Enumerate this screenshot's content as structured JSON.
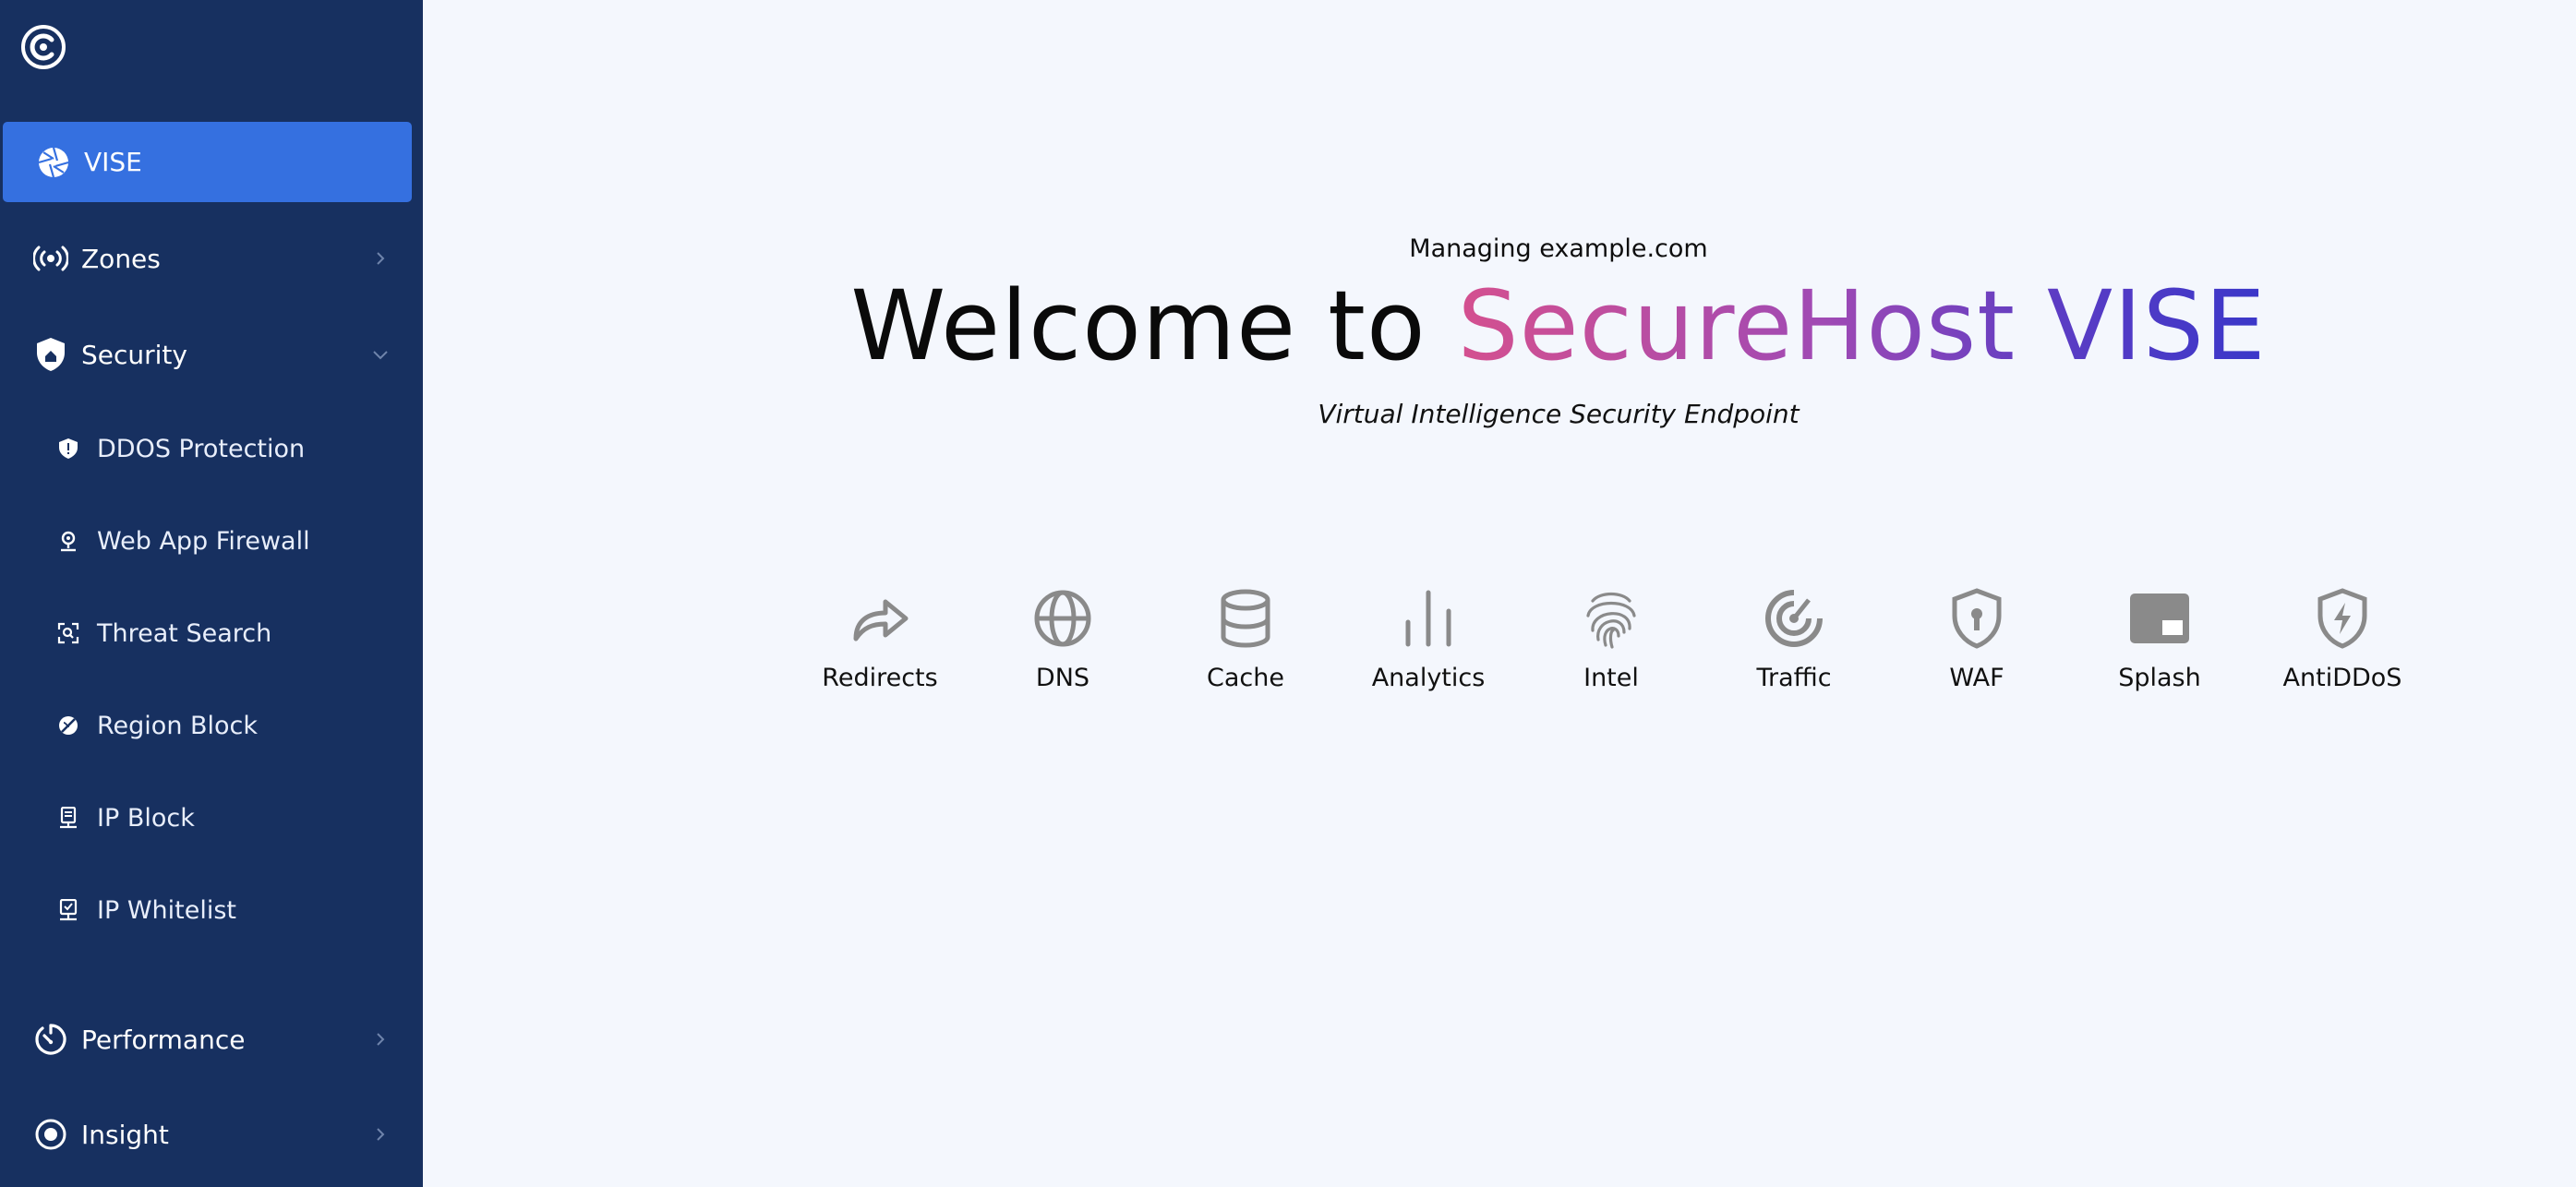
{
  "sidebar": {
    "logo_icon": "brand-logo-icon",
    "items": [
      {
        "label": "VISE",
        "icon": "aperture-icon",
        "active": true
      },
      {
        "label": "Zones",
        "icon": "broadcast-icon",
        "chevron": "chevron-right-icon"
      },
      {
        "label": "Security",
        "icon": "shield-icon",
        "chevron": "chevron-down-icon"
      },
      {
        "label": "Performance",
        "icon": "stopwatch-icon",
        "chevron": "chevron-right-icon"
      },
      {
        "label": "Insight",
        "icon": "target-icon",
        "chevron": "chevron-right-icon"
      }
    ],
    "security_sub": [
      {
        "label": "DDOS Protection",
        "icon": "shield-small-icon"
      },
      {
        "label": "Web App Firewall",
        "icon": "pin-icon"
      },
      {
        "label": "Threat Search",
        "icon": "scan-icon"
      },
      {
        "label": "Region Block",
        "icon": "globe-block-icon"
      },
      {
        "label": "IP Block",
        "icon": "server-icon"
      },
      {
        "label": "IP Whitelist",
        "icon": "monitor-icon"
      }
    ]
  },
  "main": {
    "managing": "Managing example.com",
    "welcome_prefix": "Welcome to ",
    "welcome_brand": "SecureHost VISE",
    "tagline": "Virtual Intelligence Security Endpoint",
    "features": [
      {
        "label": "Redirects",
        "icon": "redirect-arrow-icon"
      },
      {
        "label": "DNS",
        "icon": "globe-icon"
      },
      {
        "label": "Cache",
        "icon": "database-icon"
      },
      {
        "label": "Analytics",
        "icon": "bar-chart-icon"
      },
      {
        "label": "Intel",
        "icon": "fingerprint-icon"
      },
      {
        "label": "Traffic",
        "icon": "radar-icon"
      },
      {
        "label": "WAF",
        "icon": "shield-lock-icon"
      },
      {
        "label": "Splash",
        "icon": "picture-in-picture-icon"
      },
      {
        "label": "AntiDDoS",
        "icon": "shield-bolt-icon"
      }
    ]
  },
  "colors": {
    "sidebar_bg": "#173060",
    "active_bg": "#3570e0",
    "page_bg": "#f4f7fd",
    "brand_gradient_start": "#d4508f",
    "brand_gradient_end": "#3a37c9",
    "feature_icon": "#8a8a8a"
  }
}
